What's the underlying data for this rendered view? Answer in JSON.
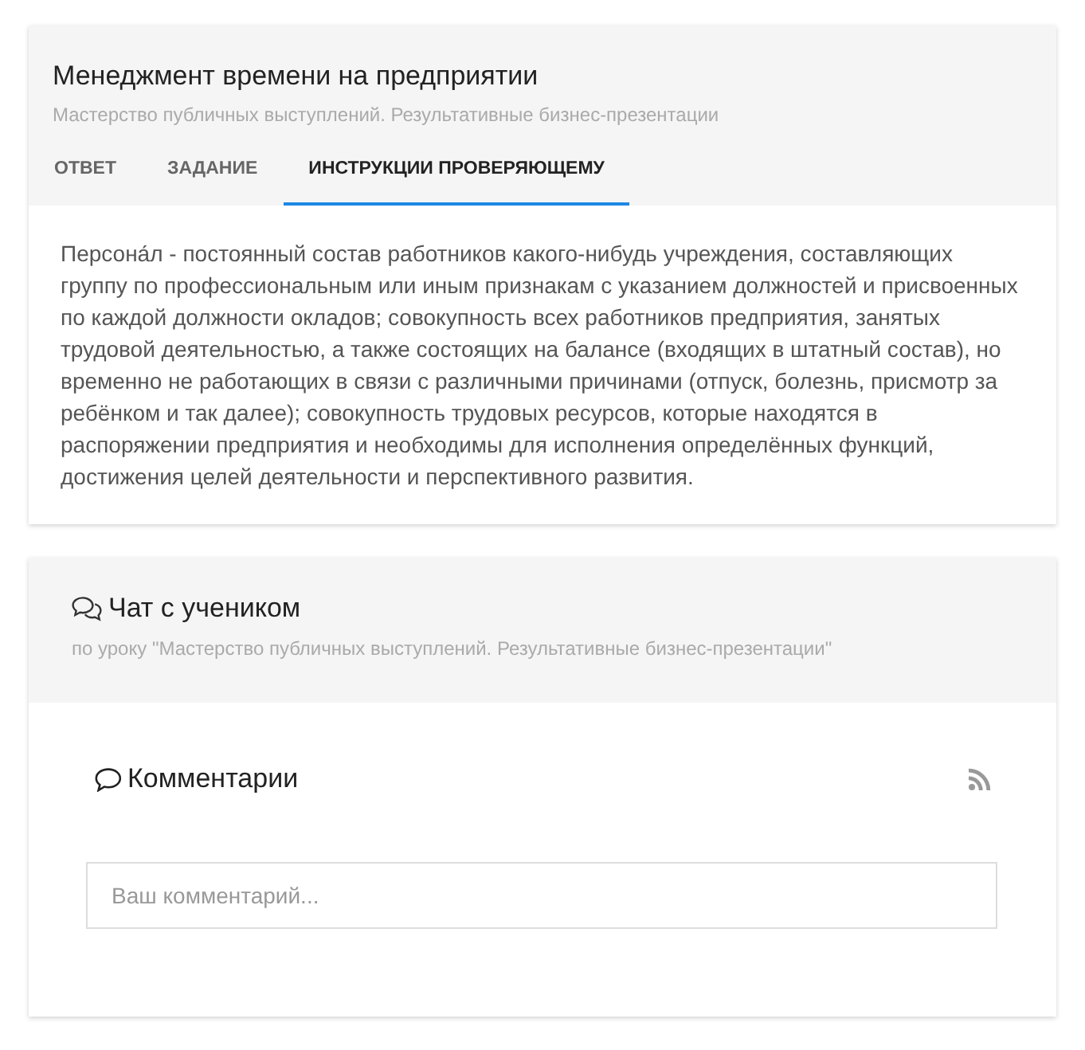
{
  "task_card": {
    "title": "Менеджмент времени на предприятии",
    "subtitle": "Мастерство публичных выступлений. Результативные бизнес-презентации",
    "tabs": [
      {
        "label": "ОТВЕТ",
        "selected": false
      },
      {
        "label": "ЗАДАНИЕ",
        "selected": false
      },
      {
        "label": "ИНСТРУКЦИИ ПРОВЕРЯЮЩЕМУ",
        "selected": true
      }
    ],
    "content": "Персона́л - постоянный состав работников какого-нибудь учреждения, составляющих группу по профессиональным или иным признакам с указанием должностей и присвоенных по каждой должности окладов; совокупность всех работников предприятия, занятых трудовой деятельностью, а также состоящих на балансе (входящих в штатный состав), но временно не работающих в связи с различными причинами (отпуск, болезнь, присмотр за ребёнком и так далее); совокупность трудовых ресурсов, которые находятся в распоряжении предприятия и необходимы для исполнения определённых функций, достижения целей деятельности и перспективного развития."
  },
  "chat_card": {
    "title": "Чат с учеником",
    "subtitle": "по уроку \"Мастерство публичных выступлений. Результативные бизнес-презентации\"",
    "comments": {
      "title": "Комментарии",
      "comment_field": {
        "placeholder": "Ваш комментарий..."
      }
    }
  }
}
